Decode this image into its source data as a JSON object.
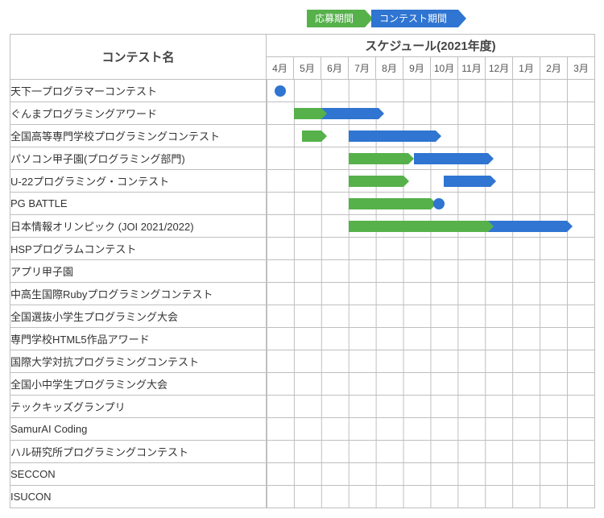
{
  "legend": {
    "apply": "応募期間",
    "contest": "コンテスト期間"
  },
  "headers": {
    "name": "コンテスト名",
    "schedule": "スケジュール(2021年度)"
  },
  "months": [
    "4月",
    "5月",
    "6月",
    "7月",
    "8月",
    "9月",
    "10月",
    "11月",
    "12月",
    "1月",
    "2月",
    "3月"
  ],
  "rows": [
    {
      "name": "天下一プログラマーコンテスト"
    },
    {
      "name": "ぐんまプログラミングアワード"
    },
    {
      "name": "全国高等専門学校プログラミングコンテスト"
    },
    {
      "name": "パソコン甲子園(プログラミング部門)"
    },
    {
      "name": "U-22プログラミング・コンテスト"
    },
    {
      "name": "PG BATTLE"
    },
    {
      "name": "日本情報オリンピック (JOI 2021/2022)"
    },
    {
      "name": "HSPプログラムコンテスト"
    },
    {
      "name": "アプリ甲子園"
    },
    {
      "name": "中高生国際Rubyプログラミングコンテスト"
    },
    {
      "name": "全国選抜小学生プログラミング大会"
    },
    {
      "name": "専門学校HTML5作品アワード"
    },
    {
      "name": "国際大学対抗プログラミングコンテスト"
    },
    {
      "name": "全国小中学生プログラミング大会"
    },
    {
      "name": "テックキッズグランプリ"
    },
    {
      "name": "SamurAI Coding"
    },
    {
      "name": "ハル研究所プログラミングコンテスト"
    },
    {
      "name": "SECCON"
    },
    {
      "name": "ISUCON"
    }
  ],
  "chart_data": {
    "type": "gantt",
    "x_categories": [
      "4月",
      "5月",
      "6月",
      "7月",
      "8月",
      "9月",
      "10月",
      "11月",
      "12月",
      "1月",
      "2月",
      "3月"
    ],
    "unit": "month-index (Apr=0 .. Mar=11, fractional allowed, end-exclusive span length)",
    "series_legend": {
      "green": "応募期間",
      "blue": "コンテスト期間"
    },
    "rows": [
      {
        "name": "天下一プログラマーコンテスト",
        "bars": [],
        "dots": [
          {
            "at": 0.5
          }
        ]
      },
      {
        "name": "ぐんまプログラミングアワード",
        "bars": [
          {
            "kind": "green",
            "start": 1.0,
            "end": 2.0
          },
          {
            "kind": "blue",
            "start": 2.0,
            "end": 4.1
          }
        ],
        "dots": []
      },
      {
        "name": "全国高等専門学校プログラミングコンテスト",
        "bars": [
          {
            "kind": "green",
            "start": 1.3,
            "end": 2.0
          },
          {
            "kind": "blue",
            "start": 3.0,
            "end": 6.2
          }
        ],
        "dots": []
      },
      {
        "name": "パソコン甲子園(プログラミング部門)",
        "bars": [
          {
            "kind": "green",
            "start": 3.0,
            "end": 5.2
          },
          {
            "kind": "blue",
            "start": 5.4,
            "end": 8.1
          }
        ],
        "dots": []
      },
      {
        "name": "U-22プログラミング・コンテスト",
        "bars": [
          {
            "kind": "green",
            "start": 3.0,
            "end": 5.0
          },
          {
            "kind": "blue",
            "start": 6.5,
            "end": 8.2
          }
        ],
        "dots": []
      },
      {
        "name": "PG BATTLE",
        "bars": [
          {
            "kind": "green",
            "start": 3.0,
            "end": 6.0
          }
        ],
        "dots": [
          {
            "at": 6.3
          }
        ]
      },
      {
        "name": "日本情報オリンピック (JOI 2021/2022)",
        "bars": [
          {
            "kind": "green",
            "start": 3.0,
            "end": 8.1
          },
          {
            "kind": "blue",
            "start": 8.1,
            "end": 11.0
          }
        ],
        "dots": []
      },
      {
        "name": "HSPプログラムコンテスト",
        "bars": [],
        "dots": []
      },
      {
        "name": "アプリ甲子園",
        "bars": [],
        "dots": []
      },
      {
        "name": "中高生国際Rubyプログラミングコンテスト",
        "bars": [],
        "dots": []
      },
      {
        "name": "全国選抜小学生プログラミング大会",
        "bars": [],
        "dots": []
      },
      {
        "name": "専門学校HTML5作品アワード",
        "bars": [],
        "dots": []
      },
      {
        "name": "国際大学対抗プログラミングコンテスト",
        "bars": [],
        "dots": []
      },
      {
        "name": "全国小中学生プログラミング大会",
        "bars": [],
        "dots": []
      },
      {
        "name": "テックキッズグランプリ",
        "bars": [],
        "dots": []
      },
      {
        "name": "SamurAI Coding",
        "bars": [],
        "dots": []
      },
      {
        "name": "ハル研究所プログラミングコンテスト",
        "bars": [],
        "dots": []
      },
      {
        "name": "SECCON",
        "bars": [],
        "dots": []
      },
      {
        "name": "ISUCON",
        "bars": [],
        "dots": []
      }
    ]
  }
}
